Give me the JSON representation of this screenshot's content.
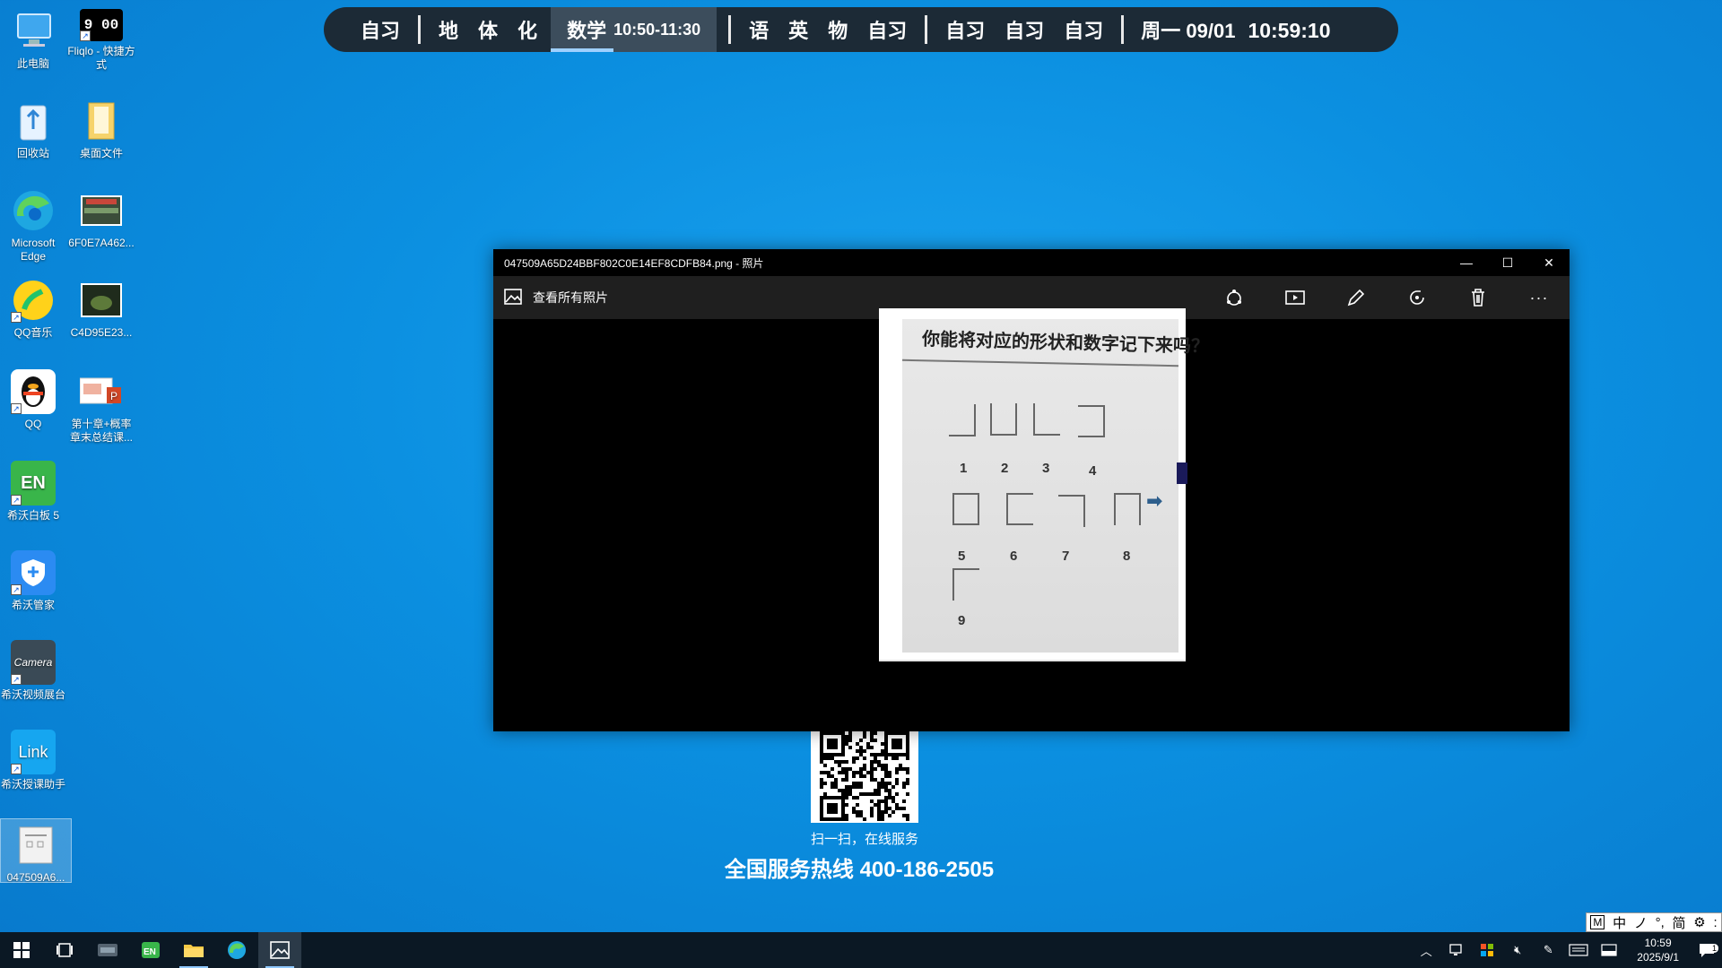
{
  "desktop_icons": [
    {
      "label": "此电脑"
    },
    {
      "label": "Fliqlo - 快捷方式",
      "clock": "9 00"
    },
    {
      "label": "回收站"
    },
    {
      "label": "桌面文件"
    },
    {
      "label": "Microsoft Edge"
    },
    {
      "label": "6F0E7A462..."
    },
    {
      "label": "QQ音乐"
    },
    {
      "label": "C4D95E23..."
    },
    {
      "label": "QQ"
    },
    {
      "label": "第十章+概率章末总结课..."
    },
    {
      "label": "希沃白板 5",
      "badge": "EN"
    },
    {
      "label": "希沃管家"
    },
    {
      "label": "希沃视频展台",
      "badge": "Camera"
    },
    {
      "label": "希沃授课助手",
      "badge": "Link"
    },
    {
      "label": "047509A6..."
    }
  ],
  "schedule": {
    "classes": [
      "自习",
      "地",
      "体",
      "化",
      "数学",
      "语",
      "英",
      "物",
      "自习",
      "自习",
      "自习",
      "自习"
    ],
    "current_time": "10:50-11:30",
    "current_progress": 0.38,
    "date": "周一 09/01",
    "clock": "10:59:10"
  },
  "photos_window": {
    "title": "047509A65D24BBF802C0E14EF8CDFB84.png - 照片",
    "view_all": "查看所有照片",
    "image": {
      "heading": "你能将对应的形状和数字记下来吗？",
      "numbers": [
        "1",
        "2",
        "3",
        "4",
        "5",
        "6",
        "7",
        "8",
        "9"
      ]
    }
  },
  "qr_label": "扫一扫，在线服务",
  "hotline": "全国服务热线 400-186-2505",
  "ime": [
    "M",
    "中",
    "ノ",
    "°,",
    "简",
    "⚙",
    ":"
  ],
  "taskbar": {
    "clock_time": "10:59",
    "clock_date": "2025/9/1",
    "notifications": "1"
  }
}
